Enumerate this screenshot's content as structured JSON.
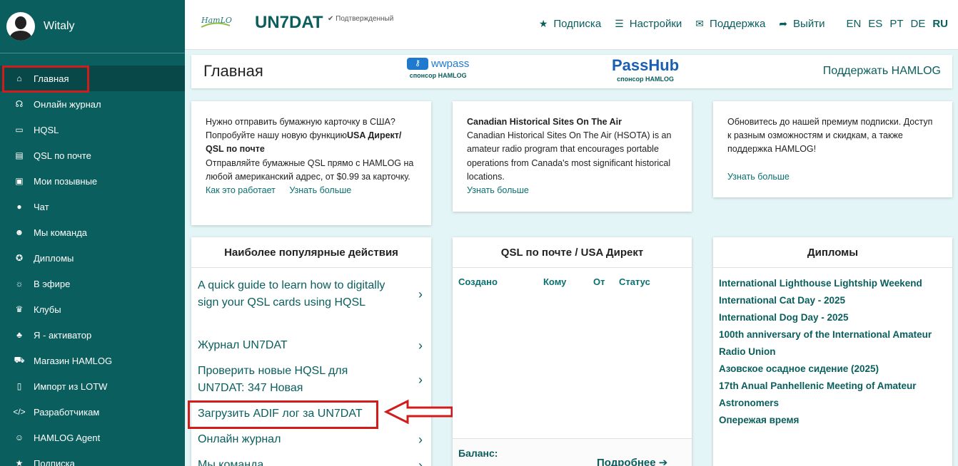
{
  "user": {
    "name": "Witaly"
  },
  "sidebar": {
    "items": [
      {
        "label": "Главная",
        "icon": "home-icon",
        "glyph": "⌂"
      },
      {
        "label": "Онлайн журнал",
        "icon": "headset-icon",
        "glyph": "☊"
      },
      {
        "label": "HQSL",
        "icon": "inbox-icon",
        "glyph": "▭"
      },
      {
        "label": "QSL по почте",
        "icon": "newspaper-icon",
        "glyph": "▤"
      },
      {
        "label": "Мои позывные",
        "icon": "id-card-icon",
        "glyph": "▣"
      },
      {
        "label": "Чат",
        "icon": "comments-icon",
        "glyph": "●"
      },
      {
        "label": "Мы команда",
        "icon": "users-icon",
        "glyph": "☻"
      },
      {
        "label": "Дипломы",
        "icon": "award-icon",
        "glyph": "✪"
      },
      {
        "label": "В эфире",
        "icon": "broadcast-icon",
        "glyph": "☼"
      },
      {
        "label": "Клубы",
        "icon": "trophy-icon",
        "glyph": "♛"
      },
      {
        "label": "Я - активатор",
        "icon": "tree-icon",
        "glyph": "♣"
      },
      {
        "label": "Магазин HAMLOG",
        "icon": "cart-icon",
        "glyph": "⛟"
      },
      {
        "label": "Импорт из LOTW",
        "icon": "file-import-icon",
        "glyph": "▯"
      },
      {
        "label": "Разработчикам",
        "icon": "code-icon",
        "glyph": "</>"
      },
      {
        "label": "HAMLOG Agent",
        "icon": "robot-icon",
        "glyph": "☺"
      },
      {
        "label": "Подписка",
        "icon": "star-icon",
        "glyph": "★"
      }
    ]
  },
  "topbar": {
    "logo_text": "HamLOG",
    "callsign": "UN7DAT",
    "verified": "✔ Подтвержденный",
    "nav": [
      {
        "label": "Подписка",
        "icon": "star-icon",
        "glyph": "★"
      },
      {
        "label": "Настройки",
        "icon": "sliders-icon",
        "glyph": "☰"
      },
      {
        "label": "Поддержка",
        "icon": "envelope-icon",
        "glyph": "✉"
      },
      {
        "label": "Выйти",
        "icon": "sign-out-icon",
        "glyph": "➦"
      }
    ],
    "langs": [
      "EN",
      "ES",
      "PT",
      "DE",
      "RU"
    ],
    "current_lang": "RU"
  },
  "header": {
    "title": "Главная",
    "sponsor1": {
      "name": "wwpass",
      "caption": "спонсор HAMLOG"
    },
    "sponsor2": {
      "name": "PassHub",
      "caption": "спонсор HAMLOG"
    },
    "support": "Поддержать HAMLOG"
  },
  "cards": {
    "usa": {
      "line1": "Нужно отправить бумажную карточку в США? Попробуйте нашу новую функцию",
      "bold": "USA Директ/ QSL по почте",
      "line2": "Отправляйте бумажные QSL прямо с HAMLOG на любой американский адрес, от $0.99 за карточку.",
      "link1": "Как это работает",
      "link2": "Узнать больше"
    },
    "hsota": {
      "title": "Canadian Historical Sites On The Air",
      "text": "Canadian Historical Sites On The Air (HSOTA) is an amateur radio program that encourages portable operations from Canada's most significant historical locations.",
      "link": "Узнать больше"
    },
    "premium": {
      "text": "Обновитесь до нашей премиум подписки. Доступ к разным озможностям и скидкам, а также поддержка HAMLOG!",
      "link": "Узнать больше"
    }
  },
  "popular": {
    "title": "Наиболее популярные действия",
    "items": [
      "A quick guide to learn how to digitally sign your QSL cards using HQSL",
      "Журнал UN7DAT",
      "Проверить новые HQSL для UN7DAT: 347 Новая",
      "Загрузить ADIF лог за UN7DAT",
      "Онлайн журнал",
      "Мы команда"
    ]
  },
  "qsl": {
    "title": "QSL по почте / USA Директ",
    "columns": [
      "Создано",
      "Кому",
      "От",
      "Статус"
    ],
    "balance_label": "Баланс:",
    "more": "Подробнее ➔"
  },
  "awards": {
    "title": "Дипломы",
    "items": [
      "International Lighthouse Lightship Weekend",
      "International Cat Day - 2025",
      "International Dog Day - 2025",
      "100th anniversary of the International Amateur Radio Union",
      "Азовское осадное сидение (2025)",
      "17th Anual Panhellenic Meeting of Amateur Astronomers",
      "Опережая время"
    ]
  },
  "colors": {
    "sidebar": "#0a5e5e",
    "accent": "#0a5e5e",
    "highlight": "#d11c1c",
    "background": "#e3f5f6"
  }
}
